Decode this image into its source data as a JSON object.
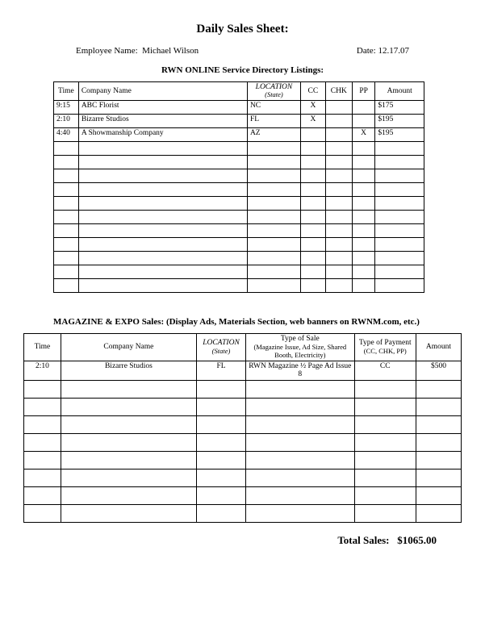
{
  "title": "Daily Sales Sheet:",
  "meta": {
    "employee_label": "Employee Name:",
    "employee_value": "Michael Wilson",
    "date_label": "Date:",
    "date_value": "12.17.07"
  },
  "section1": {
    "heading": "RWN ONLINE Service Directory Listings:",
    "headers": {
      "time": "Time",
      "company": "Company Name",
      "location": "LOCATION",
      "location_sub": "(State)",
      "cc": "CC",
      "chk": "CHK",
      "pp": "PP",
      "amount": "Amount"
    },
    "rows": [
      {
        "time": "9:15",
        "company": "ABC Florist",
        "loc": "NC",
        "cc": "X",
        "chk": "",
        "pp": "",
        "amount": "$175"
      },
      {
        "time": "2:10",
        "company": "Bizarre Studios",
        "loc": "FL",
        "cc": "X",
        "chk": "",
        "pp": "",
        "amount": "$195"
      },
      {
        "time": "4:40",
        "company": "A Showmanship Company",
        "loc": "AZ",
        "cc": "",
        "chk": "",
        "pp": "X",
        "amount": "$195"
      },
      {
        "time": "",
        "company": "",
        "loc": "",
        "cc": "",
        "chk": "",
        "pp": "",
        "amount": ""
      },
      {
        "time": "",
        "company": "",
        "loc": "",
        "cc": "",
        "chk": "",
        "pp": "",
        "amount": ""
      },
      {
        "time": "",
        "company": "",
        "loc": "",
        "cc": "",
        "chk": "",
        "pp": "",
        "amount": ""
      },
      {
        "time": "",
        "company": "",
        "loc": "",
        "cc": "",
        "chk": "",
        "pp": "",
        "amount": ""
      },
      {
        "time": "",
        "company": "",
        "loc": "",
        "cc": "",
        "chk": "",
        "pp": "",
        "amount": ""
      },
      {
        "time": "",
        "company": "",
        "loc": "",
        "cc": "",
        "chk": "",
        "pp": "",
        "amount": ""
      },
      {
        "time": "",
        "company": "",
        "loc": "",
        "cc": "",
        "chk": "",
        "pp": "",
        "amount": ""
      },
      {
        "time": "",
        "company": "",
        "loc": "",
        "cc": "",
        "chk": "",
        "pp": "",
        "amount": ""
      },
      {
        "time": "",
        "company": "",
        "loc": "",
        "cc": "",
        "chk": "",
        "pp": "",
        "amount": ""
      },
      {
        "time": "",
        "company": "",
        "loc": "",
        "cc": "",
        "chk": "",
        "pp": "",
        "amount": ""
      },
      {
        "time": "",
        "company": "",
        "loc": "",
        "cc": "",
        "chk": "",
        "pp": "",
        "amount": ""
      }
    ]
  },
  "section2": {
    "heading": "MAGAZINE & EXPO Sales: (Display Ads, Materials Section, web banners on RWNM.com, etc.)",
    "headers": {
      "time": "Time",
      "company": "Company Name",
      "location": "LOCATION",
      "location_sub": "(State)",
      "type": "Type of Sale",
      "type_sub": "(Magazine Issue, Ad Size, Shared Booth, Electricity)",
      "payment": "Type of Payment",
      "payment_sub": "(CC, CHK, PP)",
      "amount": "Amount"
    },
    "rows": [
      {
        "time": "2:10",
        "company": "Bizarre Studios",
        "loc": "FL",
        "type": "RWN Magazine ½ Page Ad Issue 8",
        "pay": "CC",
        "amount": "$500"
      },
      {
        "time": "",
        "company": "",
        "loc": "",
        "type": "",
        "pay": "",
        "amount": ""
      },
      {
        "time": "",
        "company": "",
        "loc": "",
        "type": "",
        "pay": "",
        "amount": ""
      },
      {
        "time": "",
        "company": "",
        "loc": "",
        "type": "",
        "pay": "",
        "amount": ""
      },
      {
        "time": "",
        "company": "",
        "loc": "",
        "type": "",
        "pay": "",
        "amount": ""
      },
      {
        "time": "",
        "company": "",
        "loc": "",
        "type": "",
        "pay": "",
        "amount": ""
      },
      {
        "time": "",
        "company": "",
        "loc": "",
        "type": "",
        "pay": "",
        "amount": ""
      },
      {
        "time": "",
        "company": "",
        "loc": "",
        "type": "",
        "pay": "",
        "amount": ""
      },
      {
        "time": "",
        "company": "",
        "loc": "",
        "type": "",
        "pay": "",
        "amount": ""
      }
    ]
  },
  "total": {
    "label": "Total Sales:",
    "value": "$1065.00"
  }
}
